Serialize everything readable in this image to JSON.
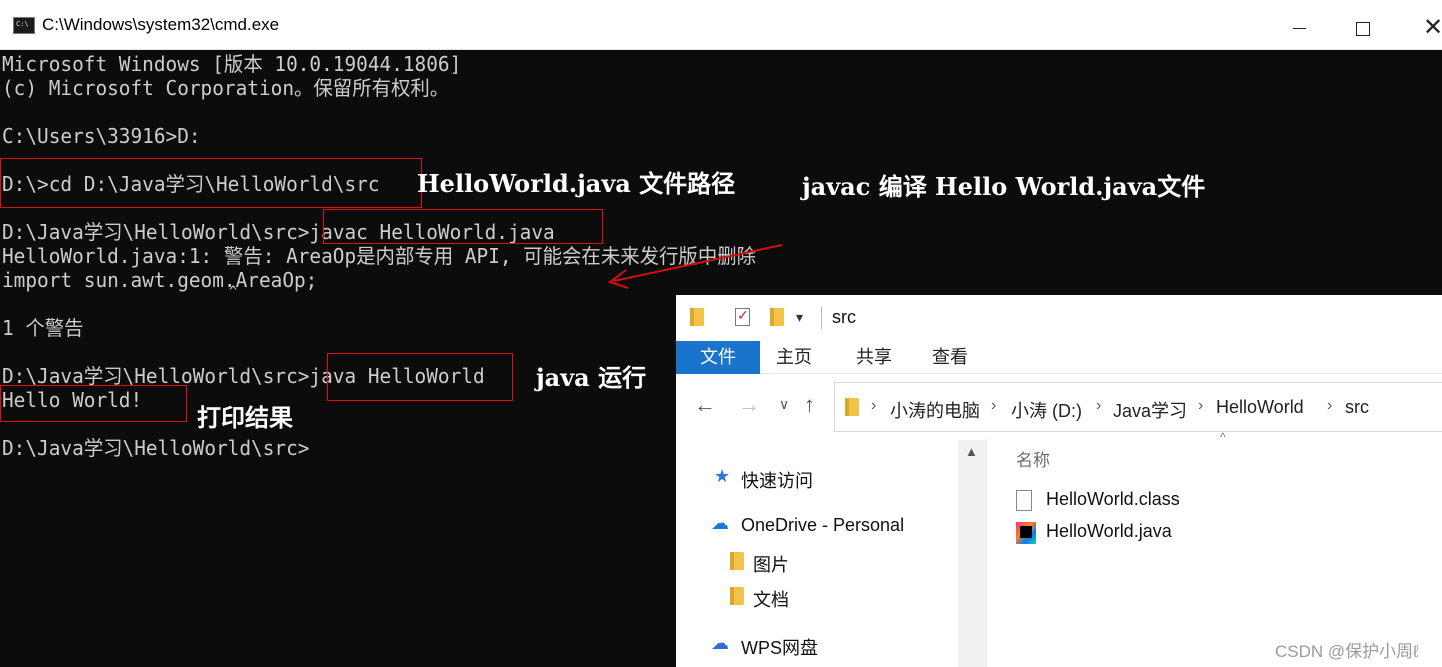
{
  "cmd": {
    "title": "C:\\Windows\\system32\\cmd.exe",
    "lines": [
      "Microsoft Windows [版本 10.0.19044.1806]",
      "(c) Microsoft Corporation。保留所有权利。",
      "",
      "C:\\Users\\33916>D:",
      "",
      "D:\\>cd D:\\Java学习\\HelloWorld\\src",
      "",
      "D:\\Java学习\\HelloWorld\\src>javac HelloWorld.java",
      "HelloWorld.java:1: 警告: AreaOp是内部专用 API, 可能会在未来发行版中删除",
      "import sun.awt.geom.AreaOp;",
      "",
      "1 个警告",
      "",
      "D:\\Java学习\\HelloWorld\\src>java HelloWorld",
      "Hello World!",
      "",
      "D:\\Java学习\\HelloWorld\\src>"
    ],
    "caret_mark": "^"
  },
  "annotations": {
    "path": "HelloWorld.java 文件路径",
    "compile": "javac 编译 Hello World.java文件",
    "run": "java 运行",
    "print": "打印结果",
    "color": "#d11111"
  },
  "explorer": {
    "qat_title": "src",
    "qat_dropdown": "▾",
    "tabs": [
      "文件",
      "主页",
      "共享",
      "查看"
    ],
    "nav_back": "←",
    "nav_forward": "→",
    "nav_recent": "∨",
    "nav_up": "↑",
    "breadcrumb": [
      "小涛的电脑",
      "小涛 (D:)",
      "Java学习",
      "HelloWorld",
      "src"
    ],
    "crumb_separator": "›",
    "nav_pane": [
      "快速访问",
      "OneDrive - Personal",
      "图片",
      "文档",
      "WPS网盘"
    ],
    "column_header": "名称",
    "sort_caret": "^",
    "files": [
      "HelloWorld.class",
      "HelloWorld.java"
    ],
    "scroll_up": "▲",
    "accent": "#1a74cc"
  },
  "watermark": "CSDN @保护小周ℓ"
}
